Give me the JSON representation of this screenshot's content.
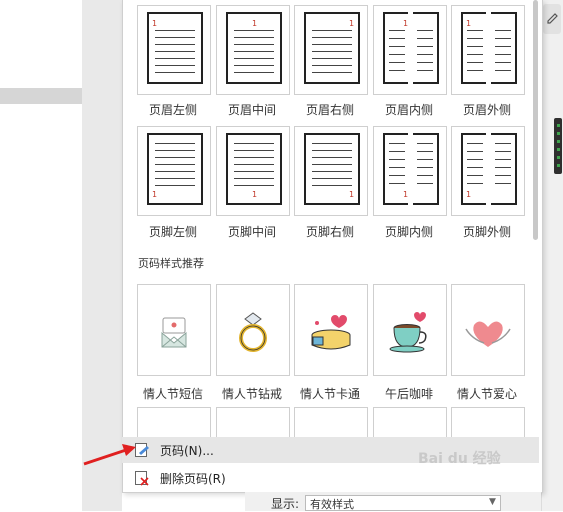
{
  "layouts": [
    {
      "label": "页眉左侧",
      "num": "1"
    },
    {
      "label": "页眉中间",
      "num": "1"
    },
    {
      "label": "页眉右侧",
      "num": "1"
    },
    {
      "label": "页眉内侧",
      "num": "1"
    },
    {
      "label": "页眉外侧",
      "num": "1"
    },
    {
      "label": "页脚左侧",
      "num": "1"
    },
    {
      "label": "页脚中间",
      "num": "1"
    },
    {
      "label": "页脚右侧",
      "num": "1"
    },
    {
      "label": "页脚内侧",
      "num": "1"
    },
    {
      "label": "页脚外侧",
      "num": "1"
    }
  ],
  "section_title": "页码样式推荐",
  "styles": [
    {
      "label": "情人节短信",
      "icon": "envelope-icon"
    },
    {
      "label": "情人节钻戒",
      "icon": "ring-icon"
    },
    {
      "label": "情人节卡通",
      "icon": "gift-icon"
    },
    {
      "label": "午后咖啡",
      "icon": "coffee-cup-icon"
    },
    {
      "label": "情人节爱心",
      "icon": "heart-hands-icon"
    }
  ],
  "menu": {
    "page_number": "页码(N)...",
    "remove_page_number": "删除页码(R)"
  },
  "status": {
    "label": "显示:",
    "value": "有效样式"
  },
  "watermark": "Bai du 经验",
  "colors": {
    "accent": "#e02020",
    "number": "#c0392b"
  }
}
